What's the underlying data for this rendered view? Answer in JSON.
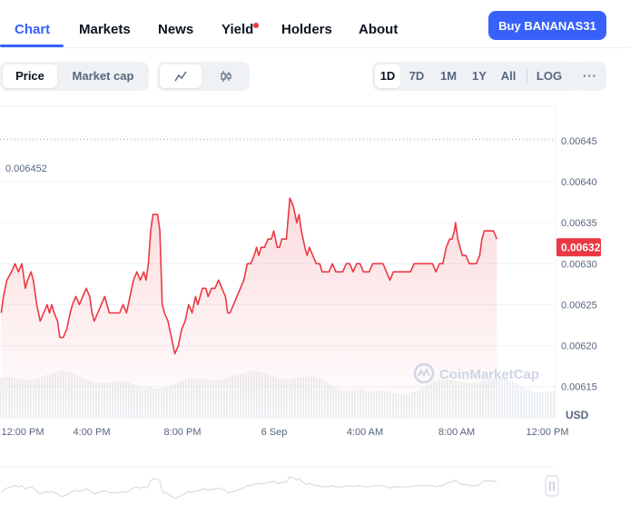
{
  "tabs": [
    {
      "label": "Chart",
      "active": true
    },
    {
      "label": "Markets",
      "active": false
    },
    {
      "label": "News",
      "active": false
    },
    {
      "label": "Yield",
      "active": false
    },
    {
      "label": "Holders",
      "active": false
    },
    {
      "label": "About",
      "active": false
    }
  ],
  "buy_label": "Buy BANANAS31",
  "metric_toggle": [
    "Price",
    "Market cap"
  ],
  "ranges": [
    "1D",
    "7D",
    "1M",
    "1Y",
    "All"
  ],
  "log_label": "LOG",
  "more_label": "···",
  "icons": {
    "line": "line-chart-icon",
    "candle": "candlestick-icon",
    "logo": "coinmarketcap-logo-icon"
  },
  "colors": {
    "line": "#ea3943",
    "accent": "#3861fb",
    "badge": "#ea3943",
    "volume": "#e6e9ee"
  },
  "watermark": "CoinMarketCap",
  "chart_data": {
    "type": "line",
    "currency": "USD",
    "high_label": "0.006452",
    "current_label": "0.00632",
    "current_value": 0.00632,
    "reference_line": 0.006452,
    "yticks": [
      0.00645,
      0.0064,
      0.00635,
      0.0063,
      0.00625,
      0.0062,
      0.00615
    ],
    "ytick_labels": [
      "0.00645",
      "0.00640",
      "0.00635",
      "0.00630",
      "0.00625",
      "0.00620",
      "0.00615"
    ],
    "ylim": [
      0.006112,
      0.006492
    ],
    "xticks": [
      "12:00 PM",
      "4:00 PM",
      "8:00 PM",
      "6 Sep",
      "4:00 AM",
      "8:00 AM",
      "12:00 PM"
    ],
    "xlim": [
      -0.05,
      24.1
    ],
    "series": [
      {
        "values": [
          [
            0,
            0.00624
          ],
          [
            0.1,
            0.00626
          ],
          [
            0.25,
            0.00628
          ],
          [
            0.45,
            0.00629
          ],
          [
            0.6,
            0.0063
          ],
          [
            0.75,
            0.00629
          ],
          [
            0.9,
            0.0063
          ],
          [
            1.05,
            0.00627
          ],
          [
            1.15,
            0.00628
          ],
          [
            1.3,
            0.00629
          ],
          [
            1.4,
            0.00628
          ],
          [
            1.55,
            0.00625
          ],
          [
            1.7,
            0.00623
          ],
          [
            1.85,
            0.00624
          ],
          [
            2.0,
            0.00625
          ],
          [
            2.1,
            0.00624
          ],
          [
            2.2,
            0.00625
          ],
          [
            2.3,
            0.00624
          ],
          [
            2.45,
            0.00623
          ],
          [
            2.55,
            0.00621
          ],
          [
            2.7,
            0.00621
          ],
          [
            2.85,
            0.00622
          ],
          [
            3.0,
            0.00624
          ],
          [
            3.1,
            0.00625
          ],
          [
            3.25,
            0.00626
          ],
          [
            3.4,
            0.00625
          ],
          [
            3.55,
            0.00626
          ],
          [
            3.7,
            0.00627
          ],
          [
            3.85,
            0.00626
          ],
          [
            3.95,
            0.00624
          ],
          [
            4.05,
            0.00623
          ],
          [
            4.2,
            0.00624
          ],
          [
            4.35,
            0.00625
          ],
          [
            4.5,
            0.00626
          ],
          [
            4.6,
            0.00625
          ],
          [
            4.7,
            0.00624
          ],
          [
            4.85,
            0.00624
          ],
          [
            5.0,
            0.00624
          ],
          [
            5.15,
            0.00624
          ],
          [
            5.3,
            0.00625
          ],
          [
            5.45,
            0.00624
          ],
          [
            5.6,
            0.00626
          ],
          [
            5.75,
            0.00628
          ],
          [
            5.9,
            0.00629
          ],
          [
            6.05,
            0.00628
          ],
          [
            6.2,
            0.00629
          ],
          [
            6.3,
            0.00628
          ],
          [
            6.4,
            0.0063
          ],
          [
            6.5,
            0.00634
          ],
          [
            6.6,
            0.00636
          ],
          [
            6.8,
            0.00636
          ],
          [
            6.9,
            0.00634
          ],
          [
            7.0,
            0.00625
          ],
          [
            7.1,
            0.00624
          ],
          [
            7.25,
            0.00623
          ],
          [
            7.4,
            0.00621
          ],
          [
            7.55,
            0.00619
          ],
          [
            7.7,
            0.0062
          ],
          [
            7.85,
            0.00622
          ],
          [
            8.0,
            0.00623
          ],
          [
            8.15,
            0.00625
          ],
          [
            8.3,
            0.00624
          ],
          [
            8.45,
            0.00626
          ],
          [
            8.55,
            0.00625
          ],
          [
            8.65,
            0.00626
          ],
          [
            8.75,
            0.00627
          ],
          [
            8.9,
            0.00627
          ],
          [
            9.0,
            0.00626
          ],
          [
            9.15,
            0.00627
          ],
          [
            9.3,
            0.00627
          ],
          [
            9.45,
            0.00628
          ],
          [
            9.6,
            0.00627
          ],
          [
            9.75,
            0.00626
          ],
          [
            9.85,
            0.00624
          ],
          [
            9.95,
            0.00624
          ],
          [
            10.1,
            0.00625
          ],
          [
            10.25,
            0.00626
          ],
          [
            10.4,
            0.00627
          ],
          [
            10.55,
            0.00628
          ],
          [
            10.7,
            0.0063
          ],
          [
            10.85,
            0.0063
          ],
          [
            11.0,
            0.00631
          ],
          [
            11.1,
            0.00632
          ],
          [
            11.2,
            0.00631
          ],
          [
            11.3,
            0.00632
          ],
          [
            11.45,
            0.00632
          ],
          [
            11.6,
            0.00633
          ],
          [
            11.75,
            0.00633
          ],
          [
            11.85,
            0.00634
          ],
          [
            12.0,
            0.00632
          ],
          [
            12.1,
            0.00632
          ],
          [
            12.2,
            0.00633
          ],
          [
            12.4,
            0.00633
          ],
          [
            12.55,
            0.00638
          ],
          [
            12.7,
            0.00637
          ],
          [
            12.85,
            0.00635
          ],
          [
            12.95,
            0.00636
          ],
          [
            13.05,
            0.00634
          ],
          [
            13.2,
            0.00632
          ],
          [
            13.3,
            0.00631
          ],
          [
            13.4,
            0.00632
          ],
          [
            13.55,
            0.00631
          ],
          [
            13.7,
            0.0063
          ],
          [
            13.85,
            0.0063
          ],
          [
            13.95,
            0.00629
          ],
          [
            14.1,
            0.00629
          ],
          [
            14.25,
            0.00629
          ],
          [
            14.4,
            0.0063
          ],
          [
            14.55,
            0.00629
          ],
          [
            14.7,
            0.00629
          ],
          [
            14.85,
            0.00629
          ],
          [
            15.0,
            0.0063
          ],
          [
            15.15,
            0.0063
          ],
          [
            15.3,
            0.00629
          ],
          [
            15.45,
            0.0063
          ],
          [
            15.6,
            0.0063
          ],
          [
            15.75,
            0.00629
          ],
          [
            15.9,
            0.00629
          ],
          [
            16.0,
            0.00629
          ],
          [
            16.15,
            0.0063
          ],
          [
            16.3,
            0.0063
          ],
          [
            16.45,
            0.0063
          ],
          [
            16.6,
            0.0063
          ],
          [
            16.75,
            0.00629
          ],
          [
            16.9,
            0.00628
          ],
          [
            17.05,
            0.00629
          ],
          [
            17.2,
            0.00629
          ],
          [
            17.35,
            0.00629
          ],
          [
            17.5,
            0.00629
          ],
          [
            17.65,
            0.00629
          ],
          [
            17.8,
            0.00629
          ],
          [
            17.95,
            0.0063
          ],
          [
            18.1,
            0.0063
          ],
          [
            18.25,
            0.0063
          ],
          [
            18.4,
            0.0063
          ],
          [
            18.6,
            0.0063
          ],
          [
            18.75,
            0.0063
          ],
          [
            18.9,
            0.00629
          ],
          [
            19.05,
            0.0063
          ],
          [
            19.2,
            0.0063
          ],
          [
            19.35,
            0.00632
          ],
          [
            19.5,
            0.00633
          ],
          [
            19.6,
            0.00633
          ],
          [
            19.7,
            0.00634
          ],
          [
            19.75,
            0.00635
          ],
          [
            19.85,
            0.00633
          ],
          [
            19.95,
            0.00632
          ],
          [
            20.05,
            0.00631
          ],
          [
            20.2,
            0.00631
          ],
          [
            20.35,
            0.0063
          ],
          [
            20.5,
            0.0063
          ],
          [
            20.65,
            0.0063
          ],
          [
            20.8,
            0.00631
          ],
          [
            20.9,
            0.00633
          ],
          [
            21.0,
            0.00634
          ],
          [
            21.1,
            0.00634
          ],
          [
            21.25,
            0.00634
          ],
          [
            21.4,
            0.00634
          ],
          [
            21.55,
            0.00633
          ]
        ]
      }
    ]
  }
}
